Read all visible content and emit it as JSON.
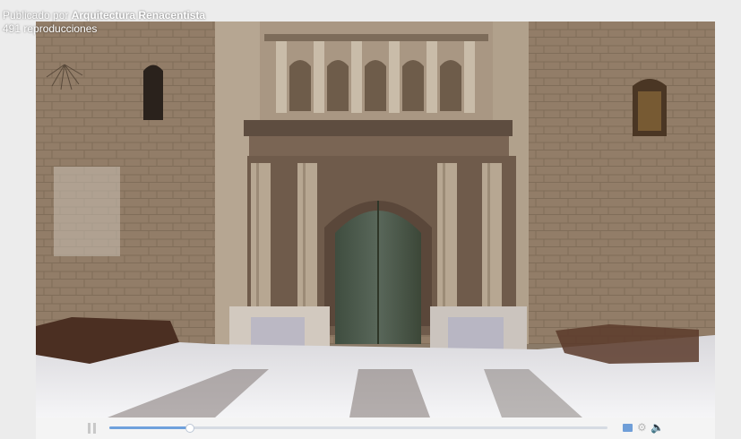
{
  "video": {
    "publisher_prefix": "Publicado por ",
    "publisher_name": "Arquitectura Renacentista",
    "views": "491 reproducciones"
  },
  "player": {
    "progress": 0.16,
    "icons": {
      "play": "pause-icon",
      "captions": "captions-icon",
      "settings": "gear-icon",
      "volume": "volume-icon"
    }
  },
  "colors": {
    "stone": "#9a8670",
    "progress_fill": "#6fa1dc"
  }
}
